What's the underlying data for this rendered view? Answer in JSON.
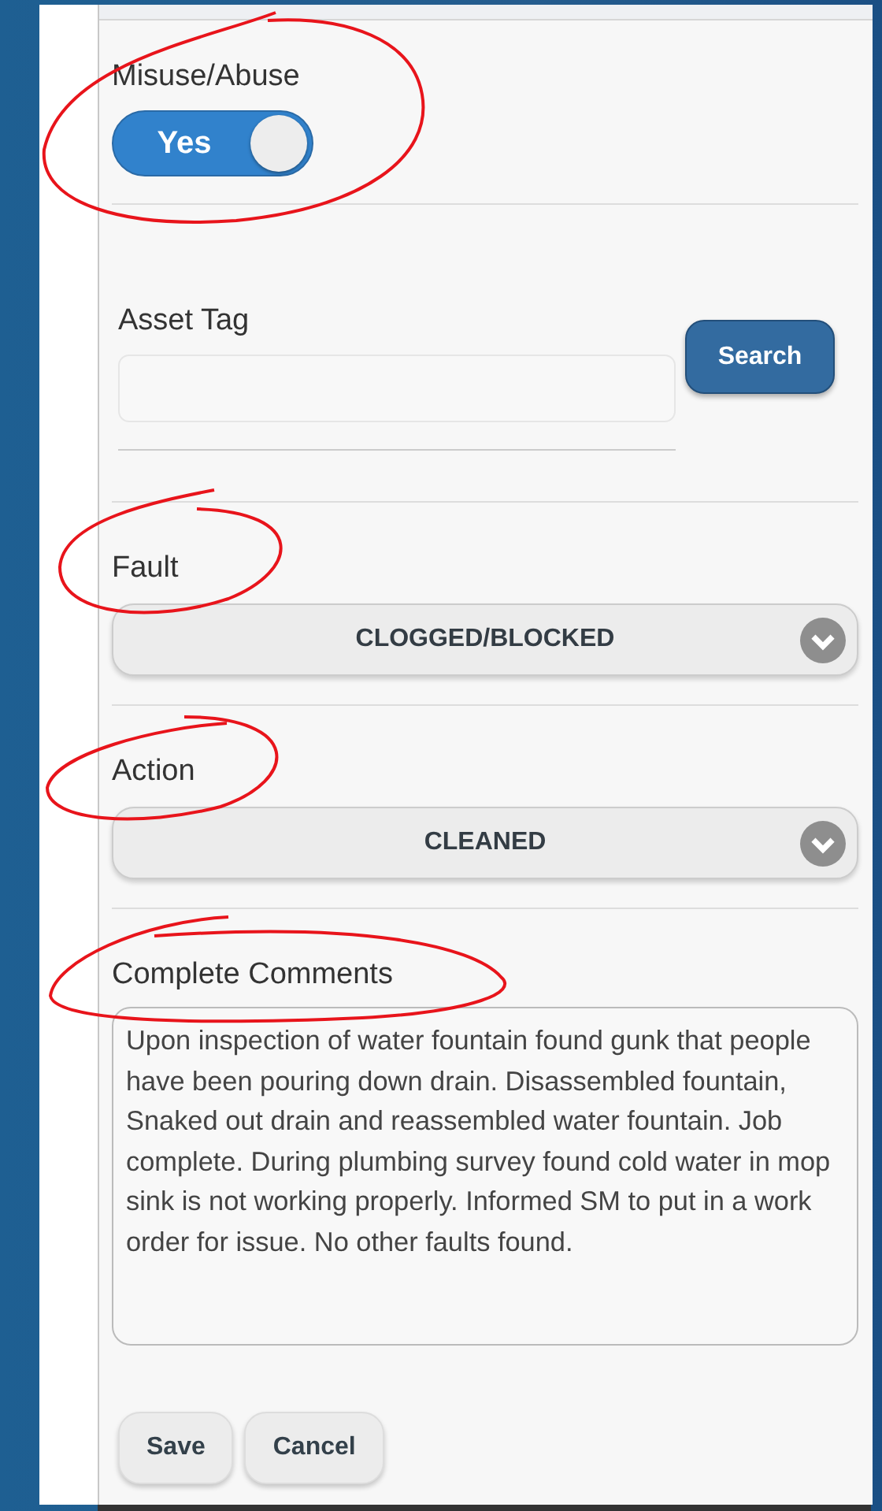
{
  "misuse_abuse": {
    "label": "Misuse/Abuse",
    "toggle_text": "Yes",
    "on": true
  },
  "asset_tag": {
    "label": "Asset Tag",
    "search_button": "Search"
  },
  "fault": {
    "label": "Fault",
    "value": "CLOGGED/BLOCKED"
  },
  "action": {
    "label": "Action",
    "value": "CLEANED"
  },
  "complete_comments": {
    "label": "Complete Comments",
    "value": "Upon inspection of water fountain found gunk that people have been pouring down drain. Disassembled fountain, Snaked out drain and reassembled water fountain. Job complete. During plumbing survey found cold water in mop sink is not working properly. Informed SM to put in a work order for issue. No other faults found."
  },
  "buttons": [
    "Save",
    "Cancel"
  ]
}
